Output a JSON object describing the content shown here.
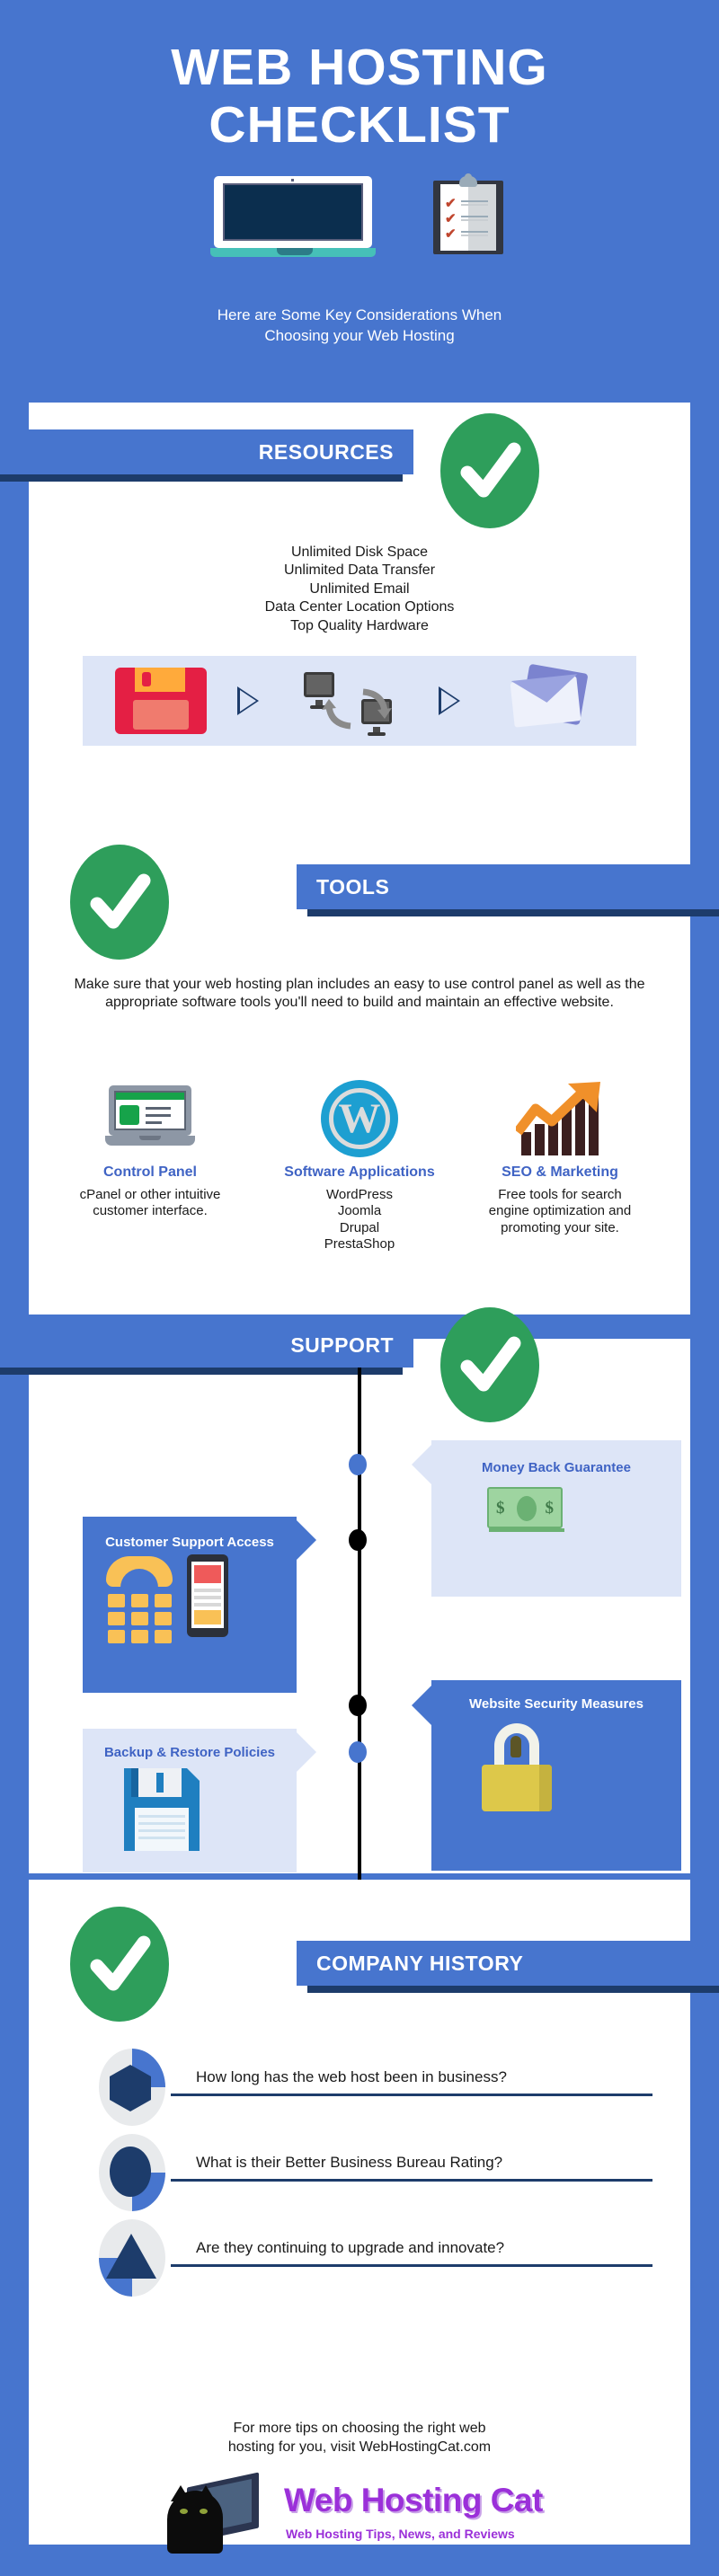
{
  "colors": {
    "brand_blue": "#4775ce",
    "dark_blue": "#1d3c6b",
    "green_check": "#2e9e5b",
    "light_blue_panel": "#dde5f7",
    "accent_text_blue": "#3f63c4",
    "logo_purple": "#9b30d9"
  },
  "hero": {
    "title_line1": "WEB HOSTING",
    "title_line2": "CHECKLIST",
    "subtitle_line1": "Here are Some Key Considerations When",
    "subtitle_line2": "Choosing your Web Hosting"
  },
  "sections": {
    "resources": {
      "label": "RESOURCES",
      "items_text": "Unlimited Disk Space\nUnlimited Data Transfer\nUnlimited Email\nData Center Location Options\nTop Quality Hardware",
      "items": [
        "Unlimited Disk Space",
        "Unlimited Data Transfer",
        "Unlimited Email",
        "Data Center Location Options",
        "Top Quality Hardware"
      ]
    },
    "tools": {
      "label": "TOOLS",
      "description": "Make sure that your web hosting plan includes an easy to use control panel as well as the appropriate software tools you'll need to build and maintain an effective website.",
      "columns": [
        {
          "title": "Control Panel",
          "icon": "laptop-control-panel-icon",
          "description": "cPanel or other intuitive customer interface."
        },
        {
          "title": "Software Applications",
          "icon": "wordpress-icon",
          "description": "WordPress\nJoomla\nDrupal\nPrestaShop"
        },
        {
          "title": "SEO & Marketing",
          "icon": "growth-chart-icon",
          "description": "Free tools for search engine optimization and promoting your site."
        }
      ]
    },
    "support": {
      "label": "SUPPORT",
      "items": [
        {
          "title": "Customer Support Access",
          "icon": "telephone-mobile-icon",
          "style": "blue",
          "side": "left"
        },
        {
          "title": "Money Back Guarantee",
          "icon": "dollar-bill-icon",
          "style": "light",
          "side": "right"
        },
        {
          "title": "Website Security Measures",
          "icon": "padlock-icon",
          "style": "blue",
          "side": "right"
        },
        {
          "title": "Backup & Restore Policies",
          "icon": "floppy-disk-icon",
          "style": "light",
          "side": "left"
        }
      ]
    },
    "company_history": {
      "label": "COMPANY HISTORY",
      "questions": [
        "How long has the web host been in business?",
        "What is their Better Business Bureau Rating?",
        "Are they continuing to upgrade and innovate?"
      ]
    }
  },
  "footer": {
    "text_line1": "For more tips on choosing the right web",
    "text_line2": "hosting for you, visit WebHostingCat.com",
    "logo_name": "Web Hosting Cat",
    "logo_tagline": "Web Hosting Tips, News, and Reviews"
  }
}
